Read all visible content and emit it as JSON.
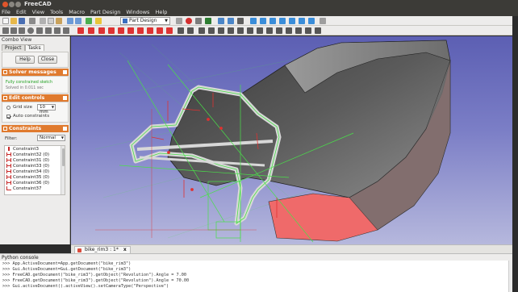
{
  "window": {
    "title": "FreeCAD"
  },
  "menu": [
    "File",
    "Edit",
    "View",
    "Tools",
    "Macro",
    "Part Design",
    "Windows",
    "Help"
  ],
  "toolbar": {
    "workbench": "Part Design",
    "icons": [
      "new-icon",
      "open-icon",
      "save-icon",
      "print-icon",
      "cut-icon",
      "copy-icon",
      "paste-icon",
      "undo-icon",
      "redo-icon",
      "refresh-icon",
      "whats-this-icon",
      "record-macro-icon",
      "stop-macro-icon",
      "macros-icon",
      "execute-macro-icon",
      "fit-all-icon",
      "fit-selection-icon",
      "draw-style-icon",
      "axonometric-icon",
      "front-view-icon",
      "top-view-icon",
      "right-view-icon",
      "rear-view-icon",
      "bottom-view-icon",
      "left-view-icon",
      "measure-icon"
    ],
    "sketcher_icons": [
      "point-icon",
      "line-icon",
      "arc-icon",
      "circle-icon",
      "conic-icon",
      "bspline-icon",
      "polyline-icon",
      "rectangle-icon",
      "polygon-icon",
      "slot-icon",
      "fillet-icon",
      "trim-icon",
      "external-geometry-icon",
      "carbon-copy-icon",
      "construction-mode-icon",
      "coincident-icon",
      "point-on-object-icon",
      "vertical-icon",
      "horizontal-icon",
      "parallel-icon",
      "perpendicular-icon",
      "tangent-icon",
      "equal-icon",
      "symmetric-icon",
      "lock-icon",
      "distance-x-icon",
      "distance-y-icon",
      "distance-icon",
      "radius-icon",
      "angle-icon",
      "snell-icon",
      "internal-alignment-icon",
      "toggle-constraint-icon"
    ]
  },
  "combo_view": {
    "title": "Combo View",
    "tabs": [
      "Project",
      "Tasks"
    ],
    "help_label": "Help",
    "close_label": "Close",
    "solver": {
      "title": "Solver messages",
      "status": "Fully constrained sketch",
      "time": "Solved in 0.011 sec"
    },
    "edit_controls": {
      "title": "Edit controls",
      "grid_size_label": "Grid size",
      "grid_size_value": "10 mm",
      "auto_constraints_label": "Auto constraints"
    },
    "constraints": {
      "title": "Constraints",
      "filter_label": "Filter:",
      "filter_value": "Normal",
      "items": [
        "Constraint3",
        "Constraint32 (0)",
        "Constraint31 (0)",
        "Constraint33 (0)",
        "Constraint34 (0)",
        "Constraint35 (0)",
        "Constraint36 (0)",
        "Constraint37"
      ]
    }
  },
  "document_tab": {
    "label": "bike_rim3 : 1*",
    "close": "x"
  },
  "python_console": {
    "title": "Python console",
    "lines": [
      ">>> App.ActiveDocument=App.getDocument(\"bike_rim3\")",
      ">>> Gui.ActiveDocument=Gui.getDocument(\"bike_rim3\")",
      ">>> FreeCAD.getDocument(\"bike_rim3\").getObject(\"Revolution\").Angle = 7.00",
      ">>> FreeCAD.getDocument(\"bike_rim3\").getObject(\"Revolution\").Angle = 70.00",
      ">>> Gui.activeDocument().activeView().setCameraType(\"Perspective\")"
    ]
  },
  "colors": {
    "section_header": "#e07a2e",
    "viewport_top": "#5c5fb3",
    "viewport_bottom": "#b6b8dd",
    "sketch_green": "#49e049",
    "constraint_red": "#e03131",
    "face_pink": "#ef6a6a"
  }
}
